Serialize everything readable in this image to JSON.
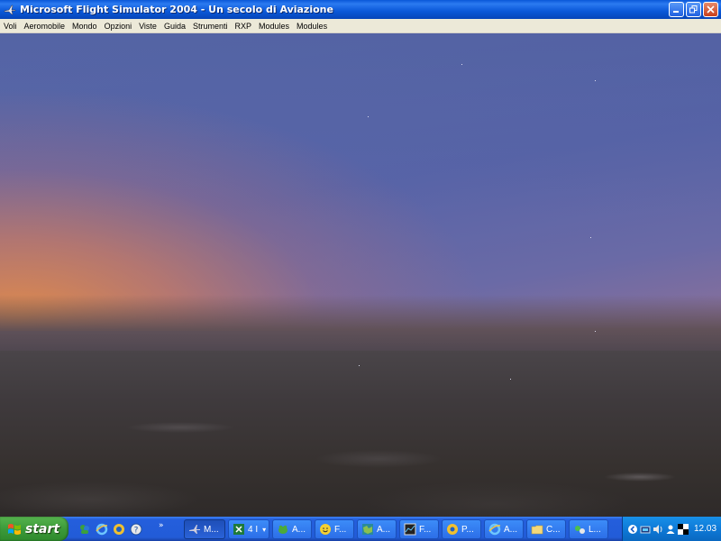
{
  "window": {
    "title": "Microsoft Flight Simulator 2004 - Un secolo di Aviazione"
  },
  "menu": {
    "items": [
      "Voli",
      "Aeromobile",
      "Mondo",
      "Opzioni",
      "Viste",
      "Guida",
      "Strumenti",
      "RXP",
      "Modules",
      "Modules"
    ]
  },
  "taskbar": {
    "start_label": "start",
    "quick_launch": [
      "messenger-icon",
      "internet-explorer-icon",
      "media-player-icon",
      "help-icon"
    ],
    "overflow_label": "»",
    "tasks": [
      {
        "label": "M...",
        "icon": "flight-simulator-icon",
        "active": true
      },
      {
        "label": "4 I",
        "icon": "excel-icon",
        "active": false,
        "dropdown": "▾"
      },
      {
        "label": "A...",
        "icon": "frog-icon",
        "active": false
      },
      {
        "label": "F...",
        "icon": "smiley-icon",
        "active": false
      },
      {
        "label": "A...",
        "icon": "globe-map-icon",
        "active": false
      },
      {
        "label": "F...",
        "icon": "graph-window-icon",
        "active": false
      },
      {
        "label": "P...",
        "icon": "paint-icon",
        "active": false
      },
      {
        "label": "A...",
        "icon": "internet-explorer-icon",
        "active": false
      },
      {
        "label": "C...",
        "icon": "folder-icon",
        "active": false
      },
      {
        "label": "L...",
        "icon": "network-icon",
        "active": false
      }
    ],
    "tray_icons": [
      "back-arrow-icon",
      "network-icon",
      "volume-icon",
      "user-icon",
      "checker-icon"
    ],
    "clock": "12.03"
  },
  "colors": {
    "titlebar": "#0a58d8",
    "menubar": "#ece9d8",
    "taskbar": "#245edc",
    "start_button": "#3c9a3a",
    "tray": "#0e7ad8"
  }
}
